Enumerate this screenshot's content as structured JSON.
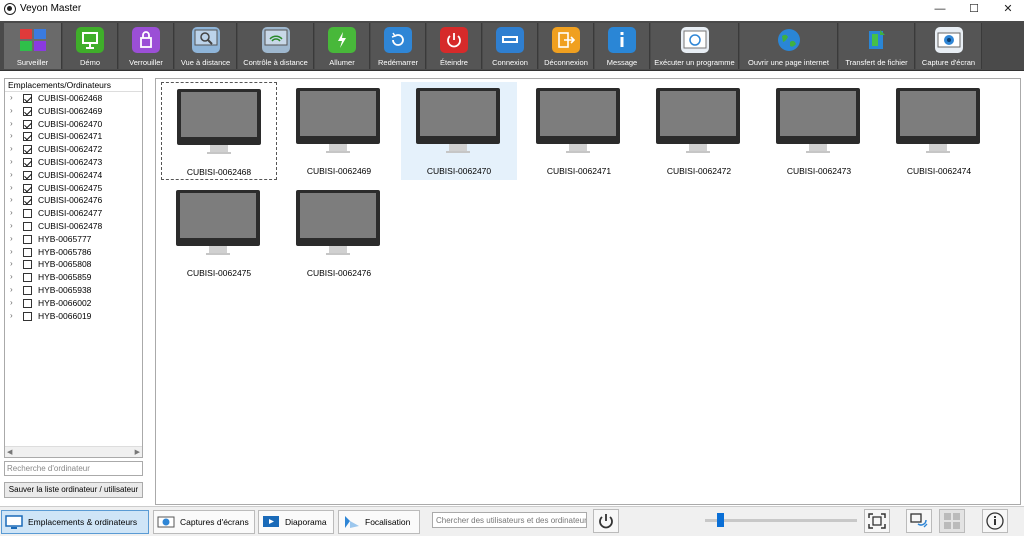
{
  "window": {
    "title": "Veyon Master",
    "minimize": "—",
    "maximize": "☐",
    "close": "✕"
  },
  "toolbar": {
    "buttons": [
      {
        "id": "surveiller",
        "label": "Surveiller",
        "icon": "monitor-grid-icon",
        "active": true
      },
      {
        "id": "demo",
        "label": "Démo",
        "icon": "presentation-icon"
      },
      {
        "id": "verrouiller",
        "label": "Verrouiller",
        "icon": "lock-icon"
      },
      {
        "id": "vue-distance",
        "label": "Vue à distance",
        "icon": "remote-view-icon"
      },
      {
        "id": "controle-distance",
        "label": "Contrôle à distance",
        "icon": "remote-control-icon"
      },
      {
        "id": "allumer",
        "label": "Allumer",
        "icon": "power-on-icon"
      },
      {
        "id": "redemarrer",
        "label": "Redémarrer",
        "icon": "restart-icon"
      },
      {
        "id": "eteindre",
        "label": "Éteindre",
        "icon": "power-off-icon"
      },
      {
        "id": "connexion",
        "label": "Connexion",
        "icon": "login-icon"
      },
      {
        "id": "deconnexion",
        "label": "Déconnexion",
        "icon": "logout-icon"
      },
      {
        "id": "message",
        "label": "Message",
        "icon": "message-icon"
      },
      {
        "id": "executer",
        "label": "Exécuter un programme",
        "icon": "run-program-icon"
      },
      {
        "id": "ouvrir-page",
        "label": "Ouvrir une page internet",
        "icon": "globe-icon"
      },
      {
        "id": "transfert",
        "label": "Transfert de fichier",
        "icon": "file-transfer-icon"
      },
      {
        "id": "capture",
        "label": "Capture d'écran",
        "icon": "camera-icon"
      }
    ]
  },
  "sidebar": {
    "header": "Emplacements/Ordinateurs",
    "items": [
      {
        "label": "CUBISI-0062468",
        "checked": true
      },
      {
        "label": "CUBISI-0062469",
        "checked": true
      },
      {
        "label": "CUBISI-0062470",
        "checked": true
      },
      {
        "label": "CUBISI-0062471",
        "checked": true
      },
      {
        "label": "CUBISI-0062472",
        "checked": true
      },
      {
        "label": "CUBISI-0062473",
        "checked": true
      },
      {
        "label": "CUBISI-0062474",
        "checked": true
      },
      {
        "label": "CUBISI-0062475",
        "checked": true
      },
      {
        "label": "CUBISI-0062476",
        "checked": true
      },
      {
        "label": "CUBISI-0062477",
        "checked": false
      },
      {
        "label": "CUBISI-0062478",
        "checked": false
      },
      {
        "label": "HYB-0065777",
        "checked": false
      },
      {
        "label": "HYB-0065786",
        "checked": false
      },
      {
        "label": "HYB-0065808",
        "checked": false
      },
      {
        "label": "HYB-0065859",
        "checked": false
      },
      {
        "label": "HYB-0065938",
        "checked": false
      },
      {
        "label": "HYB-0066002",
        "checked": false
      },
      {
        "label": "HYB-0066019",
        "checked": false
      }
    ],
    "search_placeholder": "Recherche d'ordinateur",
    "save_button": "Sauver la liste ordinateur / utilisateur"
  },
  "main": {
    "computers": [
      {
        "name": "CUBISI-0062468",
        "focused": true
      },
      {
        "name": "CUBISI-0062469"
      },
      {
        "name": "CUBISI-0062470",
        "selected": true
      },
      {
        "name": "CUBISI-0062471"
      },
      {
        "name": "CUBISI-0062472"
      },
      {
        "name": "CUBISI-0062473"
      },
      {
        "name": "CUBISI-0062474"
      },
      {
        "name": "CUBISI-0062475"
      },
      {
        "name": "CUBISI-0062476"
      }
    ]
  },
  "bottombar": {
    "tabs": [
      {
        "label": "Emplacements & ordinateurs",
        "active": true,
        "icon": "locations-icon"
      },
      {
        "label": "Captures d'écrans",
        "icon": "screenshots-icon"
      },
      {
        "label": "Diaporama",
        "icon": "slideshow-icon"
      },
      {
        "label": "Focalisation",
        "icon": "spotlight-icon"
      }
    ],
    "user_search_placeholder": "Chercher des utilisateurs et des ordinateurs",
    "zoom_level": 0.1
  },
  "colors": {
    "toolbar_bg": "#4a4a4a",
    "selection": "#e5f1fb",
    "accent": "#0a6fd6"
  }
}
